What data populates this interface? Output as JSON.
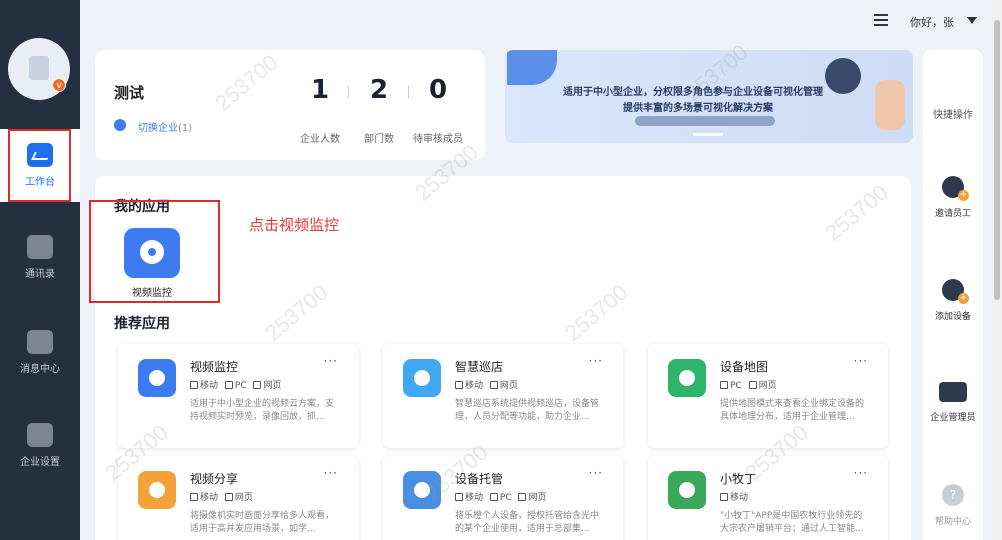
{
  "header": {
    "greeting": "你好，张"
  },
  "sidebar": {
    "items": [
      {
        "label": "工作台",
        "icon": "dashboard-icon",
        "active": true
      },
      {
        "label": "通讯录",
        "icon": "contacts-icon",
        "active": false
      },
      {
        "label": "消息中心",
        "icon": "message-icon",
        "active": false
      },
      {
        "label": "企业设置",
        "icon": "enterprise-settings-icon",
        "active": false
      }
    ]
  },
  "company": {
    "name": "测试",
    "switch_label": "切换企业",
    "switch_count": "(1)"
  },
  "stats": [
    {
      "value": "1",
      "label": "企业人数"
    },
    {
      "value": "2",
      "label": "部门数"
    },
    {
      "value": "0",
      "label": "待审核成员"
    }
  ],
  "banner": {
    "line1": "适用于中小型企业，分权限多角色参与企业设备可视化管理",
    "line2": "提供丰富的多场景可视化解决方案"
  },
  "quick_actions": {
    "title": "快捷操作",
    "items": [
      {
        "label": "邀请员工",
        "icon": "invite-user-icon"
      },
      {
        "label": "添加设备",
        "icon": "add-device-icon"
      },
      {
        "label": "企业管理员",
        "icon": "admin-card-icon"
      },
      {
        "label": "帮助中心",
        "icon": "help-icon"
      }
    ]
  },
  "my_apps": {
    "title": "我的应用",
    "items": [
      {
        "label": "视频监控",
        "icon": "video-monitor-icon"
      }
    ]
  },
  "instruction": "点击视频监控",
  "recommended": {
    "title": "推荐应用",
    "apps": [
      {
        "name": "视频监控",
        "tags": [
          "移动",
          "PC",
          "网页"
        ],
        "desc": "适用于中小型企业的视频云方案，支持视频实时预览，录像回放，抓...",
        "icon": "video-monitor-icon",
        "color": "#3f7bf0"
      },
      {
        "name": "智慧巡店",
        "tags": [
          "移动",
          "网页"
        ],
        "desc": "智慧巡店系统提供视频巡店，设备管理，人员分配等功能，助力企业...",
        "icon": "store-icon",
        "color": "#3fa8f0"
      },
      {
        "name": "设备地图",
        "tags": [
          "PC",
          "网页"
        ],
        "desc": "提供地图模式来查看企业绑定设备的具体地理分布，适用于企业管理...",
        "icon": "map-pin-icon",
        "color": "#2fb56a"
      },
      {
        "name": "视频分享",
        "tags": [
          "移动",
          "网页"
        ],
        "desc": "将摄像机实时画面分享给多人观看，适用于高并发应用场景，如学...",
        "icon": "video-share-icon",
        "color": "#f3a23a"
      },
      {
        "name": "设备托管",
        "tags": [
          "移动",
          "PC",
          "网页"
        ],
        "desc": "将乐橙个人设备，授权托管给含光中的某个企业使用，适用于总部集...",
        "icon": "device-hosting-icon",
        "color": "#4a90e2"
      },
      {
        "name": "小牧丁",
        "tags": [
          "移动"
        ],
        "desc": "\"小牧丁\"APP是中国农牧行业领先的大宗农产屠销平台；通过人工智能...",
        "icon": "xiaomuding-icon",
        "color": "#3aa85a"
      }
    ]
  },
  "watermark": "253700"
}
